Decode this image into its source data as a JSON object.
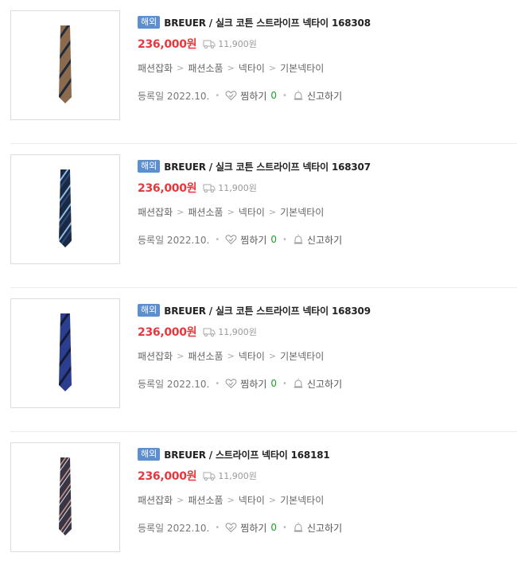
{
  "products": [
    {
      "badge": "해외",
      "title": "BREUER / 실크 코튼 스트라이프 넥타이 168308",
      "price": "236,000원",
      "shipping": "11,900원",
      "categories": [
        "패션잡화",
        "패션소품",
        "넥타이",
        "기본넥타이"
      ],
      "date_label": "등록일 2022.10.",
      "zzim_label": "찜하기",
      "zzim_count": "0",
      "report_label": "신고하기",
      "tie": {
        "base": "#8b6a4e",
        "stripe": "#1f2a3a",
        "stripe2": "#1f2a3a"
      }
    },
    {
      "badge": "해외",
      "title": "BREUER / 실크 코튼 스트라이프 넥타이 168307",
      "price": "236,000원",
      "shipping": "11,900원",
      "categories": [
        "패션잡화",
        "패션소품",
        "넥타이",
        "기본넥타이"
      ],
      "date_label": "등록일 2022.10.",
      "zzim_label": "찜하기",
      "zzim_count": "0",
      "report_label": "신고하기",
      "tie": {
        "base": "#1b2a44",
        "stripe": "#8fbde6",
        "stripe2": "#2e4d7a"
      }
    },
    {
      "badge": "해외",
      "title": "BREUER / 실크 코튼 스트라이프 넥타이 168309",
      "price": "236,000원",
      "shipping": "11,900원",
      "categories": [
        "패션잡화",
        "패션소품",
        "넥타이",
        "기본넥타이"
      ],
      "date_label": "등록일 2022.10.",
      "zzim_label": "찜하기",
      "zzim_count": "0",
      "report_label": "신고하기",
      "tie": {
        "base": "#2c3f8f",
        "stripe": "#141c3a",
        "stripe2": "#141c3a"
      }
    },
    {
      "badge": "해외",
      "title": "BREUER / 스트라이프 넥타이 168181",
      "price": "236,000원",
      "shipping": "11,900원",
      "categories": [
        "패션잡화",
        "패션소품",
        "넥타이",
        "기본넥타이"
      ],
      "date_label": "등록일 2022.10.",
      "zzim_label": "찜하기",
      "zzim_count": "0",
      "report_label": "신고하기",
      "tie": {
        "base": "#3a3545",
        "stripe": "#c89a8a",
        "stripe2": "#e8e0e0"
      }
    }
  ]
}
